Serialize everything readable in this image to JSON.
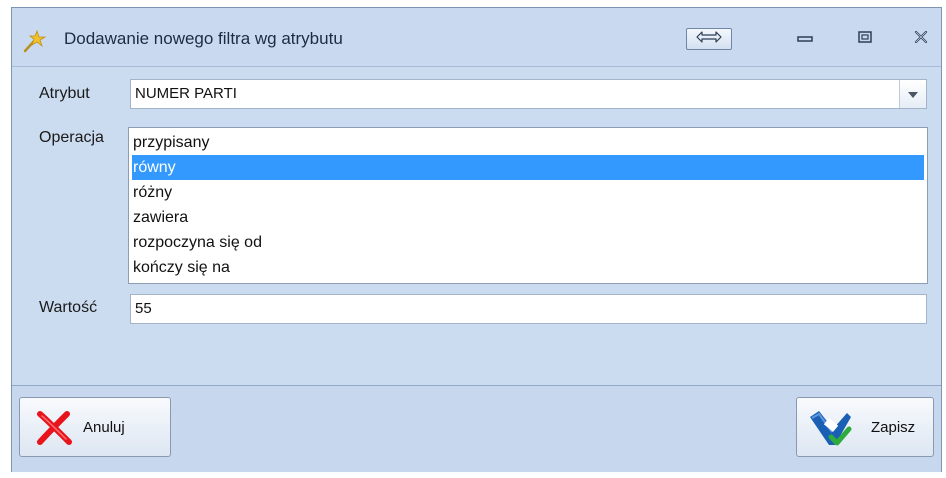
{
  "window": {
    "title": "Dodawanie nowego filtra wg atrybutu",
    "controls": [
      "resize-horizontal",
      "minimize",
      "maximize",
      "close"
    ]
  },
  "form": {
    "attribute_label": "Atrybut",
    "attribute_value": "NUMER PARTI",
    "operation_label": "Operacja",
    "operations": [
      "przypisany",
      "równy",
      "różny",
      "zawiera",
      "rozpoczyna się od",
      "kończy się na"
    ],
    "selected_operation": "równy",
    "value_label": "Wartość",
    "value": "55"
  },
  "buttons": {
    "cancel_label": "Anuluj",
    "save_label": "Zapisz"
  },
  "colors": {
    "window_bg": "#c9daf0",
    "selection": "#3399ff",
    "cancel_icon": "#e8141c",
    "save_icon": "#1a5fb4",
    "check_icon": "#2faa3c"
  }
}
